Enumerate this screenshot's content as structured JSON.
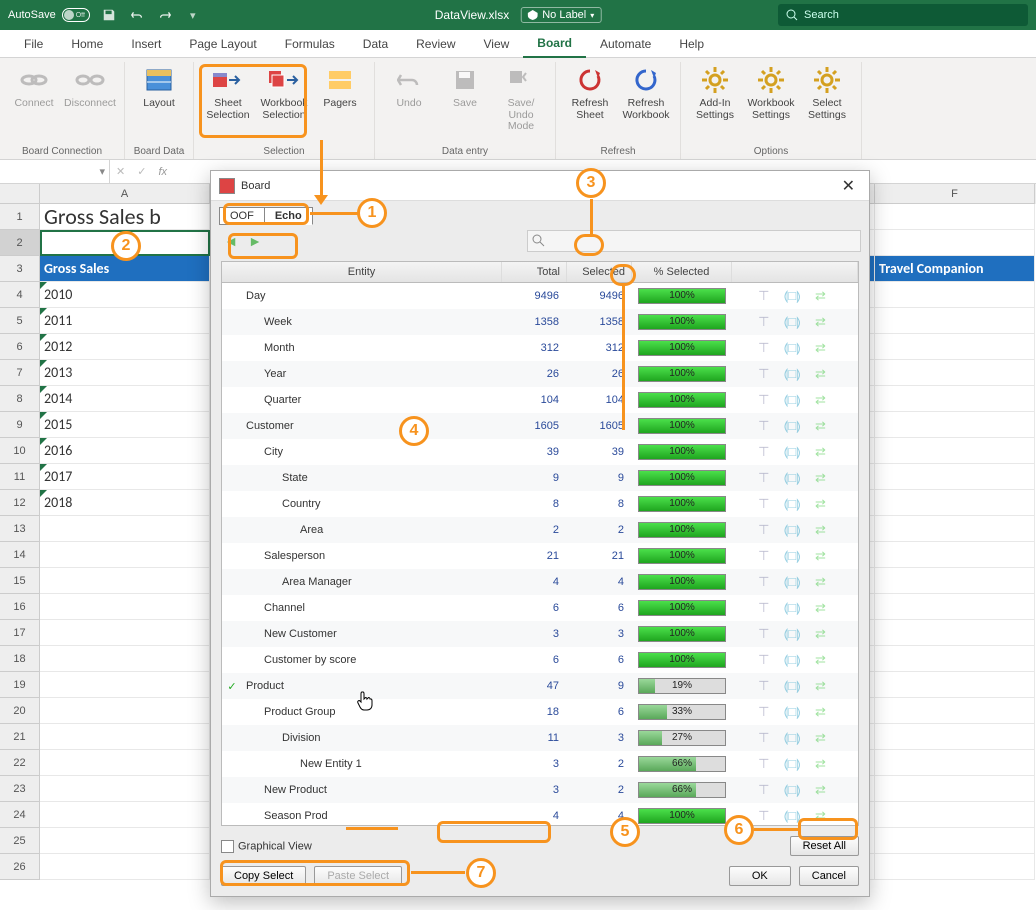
{
  "titlebar": {
    "autosave_label": "AutoSave",
    "autosave_state": "Off",
    "filename": "DataView.xlsx",
    "nolabel": "No Label",
    "search_placeholder": "Search"
  },
  "tabs": [
    "File",
    "Home",
    "Insert",
    "Page Layout",
    "Formulas",
    "Data",
    "Review",
    "View",
    "Board",
    "Automate",
    "Help"
  ],
  "active_tab": "Board",
  "ribbon": {
    "groups": [
      {
        "label": "Board Connection",
        "buttons": [
          {
            "label": "Connect",
            "icon": "link",
            "disabled": true
          },
          {
            "label": "Disconnect",
            "icon": "unlink",
            "disabled": true
          }
        ]
      },
      {
        "label": "Board Data",
        "buttons": [
          {
            "label": "Layout",
            "icon": "layout"
          }
        ]
      },
      {
        "label": "Selection",
        "highlight": true,
        "buttons": [
          {
            "label": "Sheet Selection",
            "icon": "sheet-sel"
          },
          {
            "label": "Workbook Selection",
            "icon": "wb-sel"
          },
          {
            "label": "Pagers",
            "icon": "pagers"
          }
        ]
      },
      {
        "label": "Data entry",
        "buttons": [
          {
            "label": "Undo",
            "icon": "undo",
            "disabled": true
          },
          {
            "label": "Save",
            "icon": "save",
            "disabled": true
          },
          {
            "label": "Save/Undo Mode",
            "icon": "savemode",
            "disabled": true
          }
        ]
      },
      {
        "label": "Refresh",
        "buttons": [
          {
            "label": "Refresh Sheet",
            "icon": "refresh1"
          },
          {
            "label": "Refresh Workbook",
            "icon": "refresh2"
          }
        ]
      },
      {
        "label": "Options",
        "buttons": [
          {
            "label": "Add-In Settings",
            "icon": "gear"
          },
          {
            "label": "Workbook Settings",
            "icon": "gear"
          },
          {
            "label": "Select Settings",
            "icon": "gear"
          }
        ]
      }
    ]
  },
  "formula_bar": {
    "namebox": "",
    "fx": "fx",
    "value": ""
  },
  "sheet": {
    "columns": [
      "A",
      "F"
    ],
    "colA_width": 170,
    "visible_cell_a1": "Gross Sales b",
    "visible_cell_f3": "Travel Companion",
    "blue_header_a3": "Gross Sales",
    "rows": [
      {
        "r": 4,
        "a": "2010"
      },
      {
        "r": 5,
        "a": "2011"
      },
      {
        "r": 6,
        "a": "2012"
      },
      {
        "r": 7,
        "a": "2013"
      },
      {
        "r": 8,
        "a": "2014"
      },
      {
        "r": 9,
        "a": "2015"
      },
      {
        "r": 10,
        "a": "2016"
      },
      {
        "r": 11,
        "a": "2017"
      },
      {
        "r": 12,
        "a": "2018"
      }
    ],
    "row_count": 26
  },
  "dialog": {
    "title": "Board",
    "model_tabs": [
      "OOF",
      "Echo"
    ],
    "active_model_tab": "Echo",
    "columns": [
      "Entity",
      "Total",
      "Selected",
      "% Selected"
    ],
    "entities": [
      {
        "indent": 0,
        "name": "Day",
        "total": 9496,
        "selected": 9496,
        "pct": 100
      },
      {
        "indent": 1,
        "name": "Week",
        "total": 1358,
        "selected": 1358,
        "pct": 100
      },
      {
        "indent": 1,
        "name": "Month",
        "total": 312,
        "selected": 312,
        "pct": 100
      },
      {
        "indent": 1,
        "name": "Year",
        "total": 26,
        "selected": 26,
        "pct": 100
      },
      {
        "indent": 1,
        "name": "Quarter",
        "total": 104,
        "selected": 104,
        "pct": 100
      },
      {
        "indent": 0,
        "name": "Customer",
        "total": 1605,
        "selected": 1605,
        "pct": 100
      },
      {
        "indent": 1,
        "name": "City",
        "total": 39,
        "selected": 39,
        "pct": 100
      },
      {
        "indent": 2,
        "name": "State",
        "total": 9,
        "selected": 9,
        "pct": 100
      },
      {
        "indent": 2,
        "name": "Country",
        "total": 8,
        "selected": 8,
        "pct": 100
      },
      {
        "indent": 3,
        "name": "Area",
        "total": 2,
        "selected": 2,
        "pct": 100
      },
      {
        "indent": 1,
        "name": "Salesperson",
        "total": 21,
        "selected": 21,
        "pct": 100
      },
      {
        "indent": 2,
        "name": "Area Manager",
        "total": 4,
        "selected": 4,
        "pct": 100
      },
      {
        "indent": 1,
        "name": "Channel",
        "total": 6,
        "selected": 6,
        "pct": 100
      },
      {
        "indent": 1,
        "name": "New Customer",
        "total": 3,
        "selected": 3,
        "pct": 100
      },
      {
        "indent": 1,
        "name": "Customer by score",
        "total": 6,
        "selected": 6,
        "pct": 100
      },
      {
        "indent": 0,
        "name": "Product",
        "checked": true,
        "total": 47,
        "selected": 9,
        "pct": 19,
        "hover": true
      },
      {
        "indent": 1,
        "name": "Product Group",
        "total": 18,
        "selected": 6,
        "pct": 33
      },
      {
        "indent": 2,
        "name": "Division",
        "total": 11,
        "selected": 3,
        "pct": 27
      },
      {
        "indent": 3,
        "name": "New Entity 1",
        "total": 3,
        "selected": 2,
        "pct": 66
      },
      {
        "indent": 1,
        "name": "New Product",
        "total": 3,
        "selected": 2,
        "pct": 66
      },
      {
        "indent": 1,
        "name": "Season Prod",
        "partial": true,
        "total": 4,
        "selected": 4,
        "pct": 100
      }
    ],
    "graphical_view": "Graphical View",
    "copy_select": "Copy Select",
    "paste_select": "Paste Select",
    "reset_all": "Reset All",
    "ok": "OK",
    "cancel": "Cancel"
  },
  "callouts": [
    "1",
    "2",
    "3",
    "4",
    "5",
    "6",
    "7"
  ]
}
